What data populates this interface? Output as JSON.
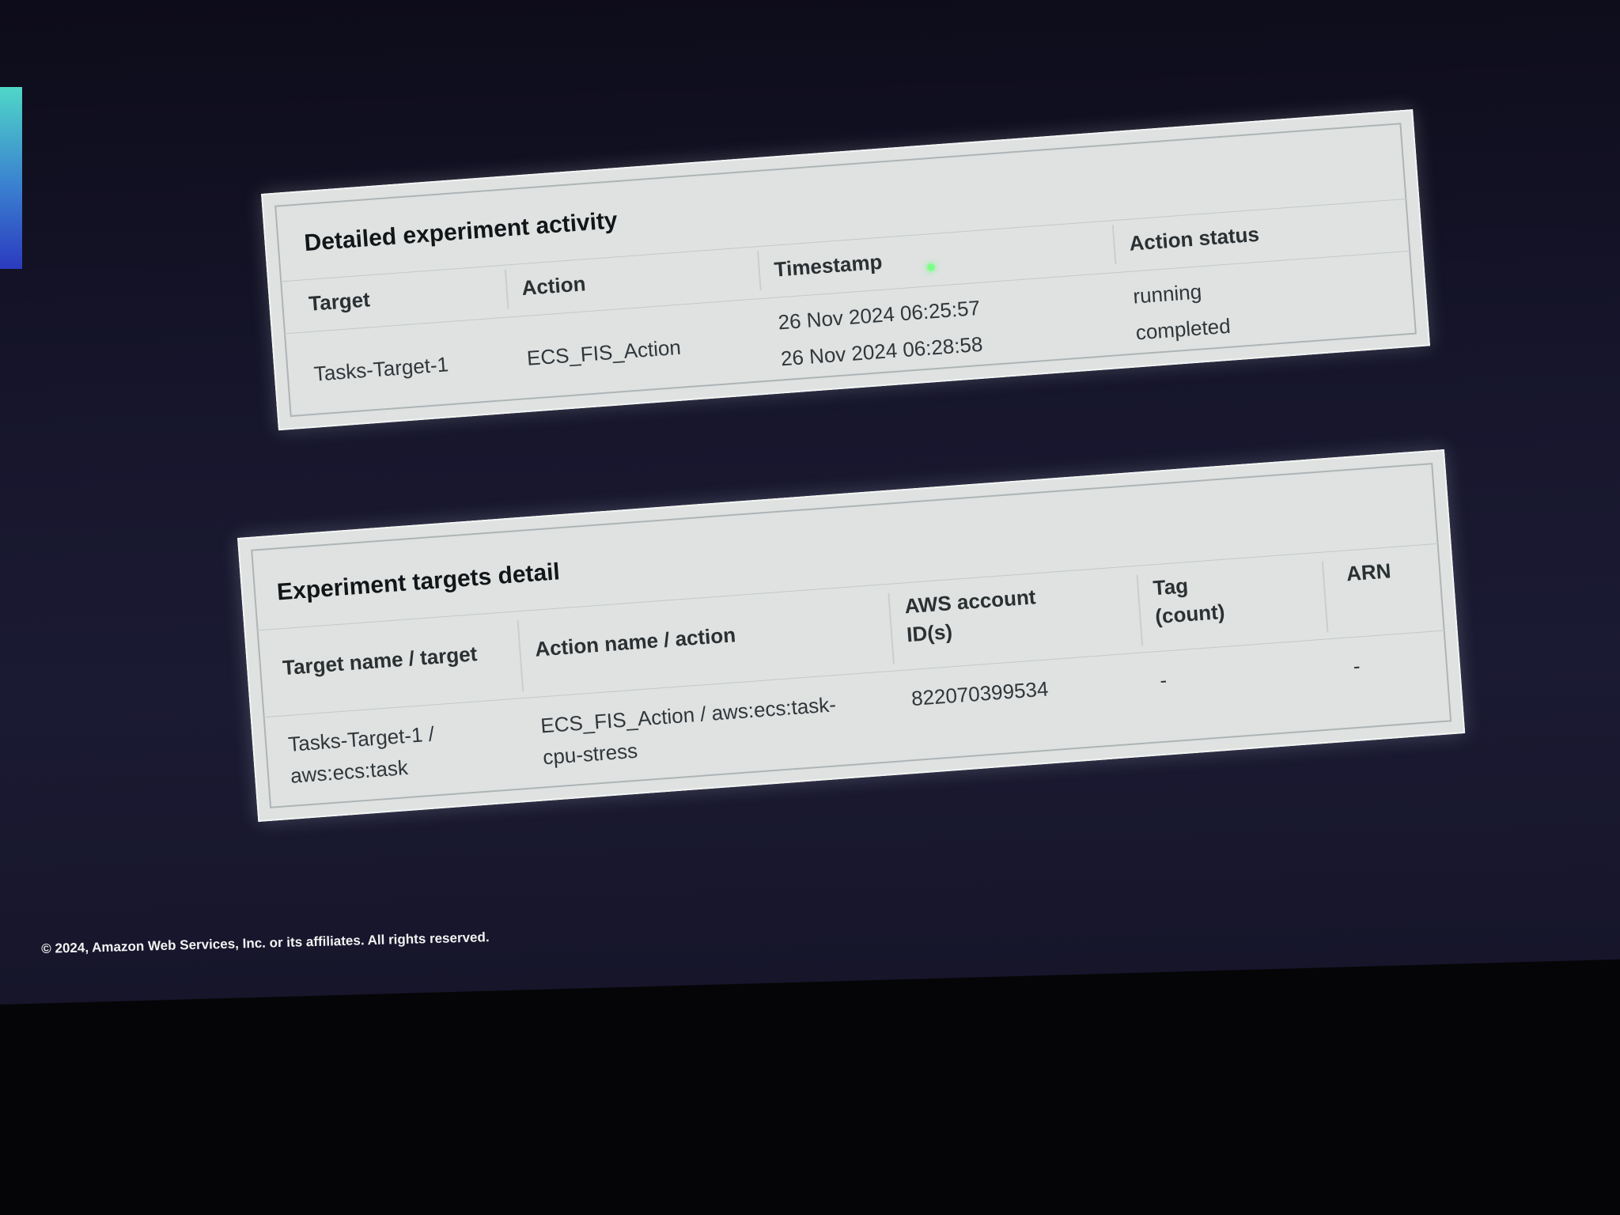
{
  "activity": {
    "title": "Detailed experiment activity",
    "headers": {
      "target": "Target",
      "action": "Action",
      "timestamp": "Timestamp",
      "status": "Action status"
    },
    "target": "Tasks-Target-1",
    "action": "ECS_FIS_Action",
    "rows": [
      {
        "timestamp": "26 Nov 2024 06:25:57",
        "status": "running"
      },
      {
        "timestamp": "26 Nov 2024 06:28:58",
        "status": "completed"
      }
    ]
  },
  "targets": {
    "title": "Experiment targets detail",
    "headers": {
      "target": "Target name / target",
      "action": "Action name / action",
      "account_line1": "AWS account",
      "account_line2": "ID(s)",
      "tag_line1": "Tag",
      "tag_line2": "(count)",
      "arn": "ARN"
    },
    "row": {
      "target_line1": "Tasks-Target-1 /",
      "target_line2": "aws:ecs:task",
      "action_line1": "ECS_FIS_Action / aws:ecs:task-",
      "action_line2": "cpu-stress",
      "account": "822070399534",
      "tag": "-",
      "arn": "-"
    }
  },
  "footer": "© 2024, Amazon Web Services, Inc. or its affiliates. All rights reserved."
}
